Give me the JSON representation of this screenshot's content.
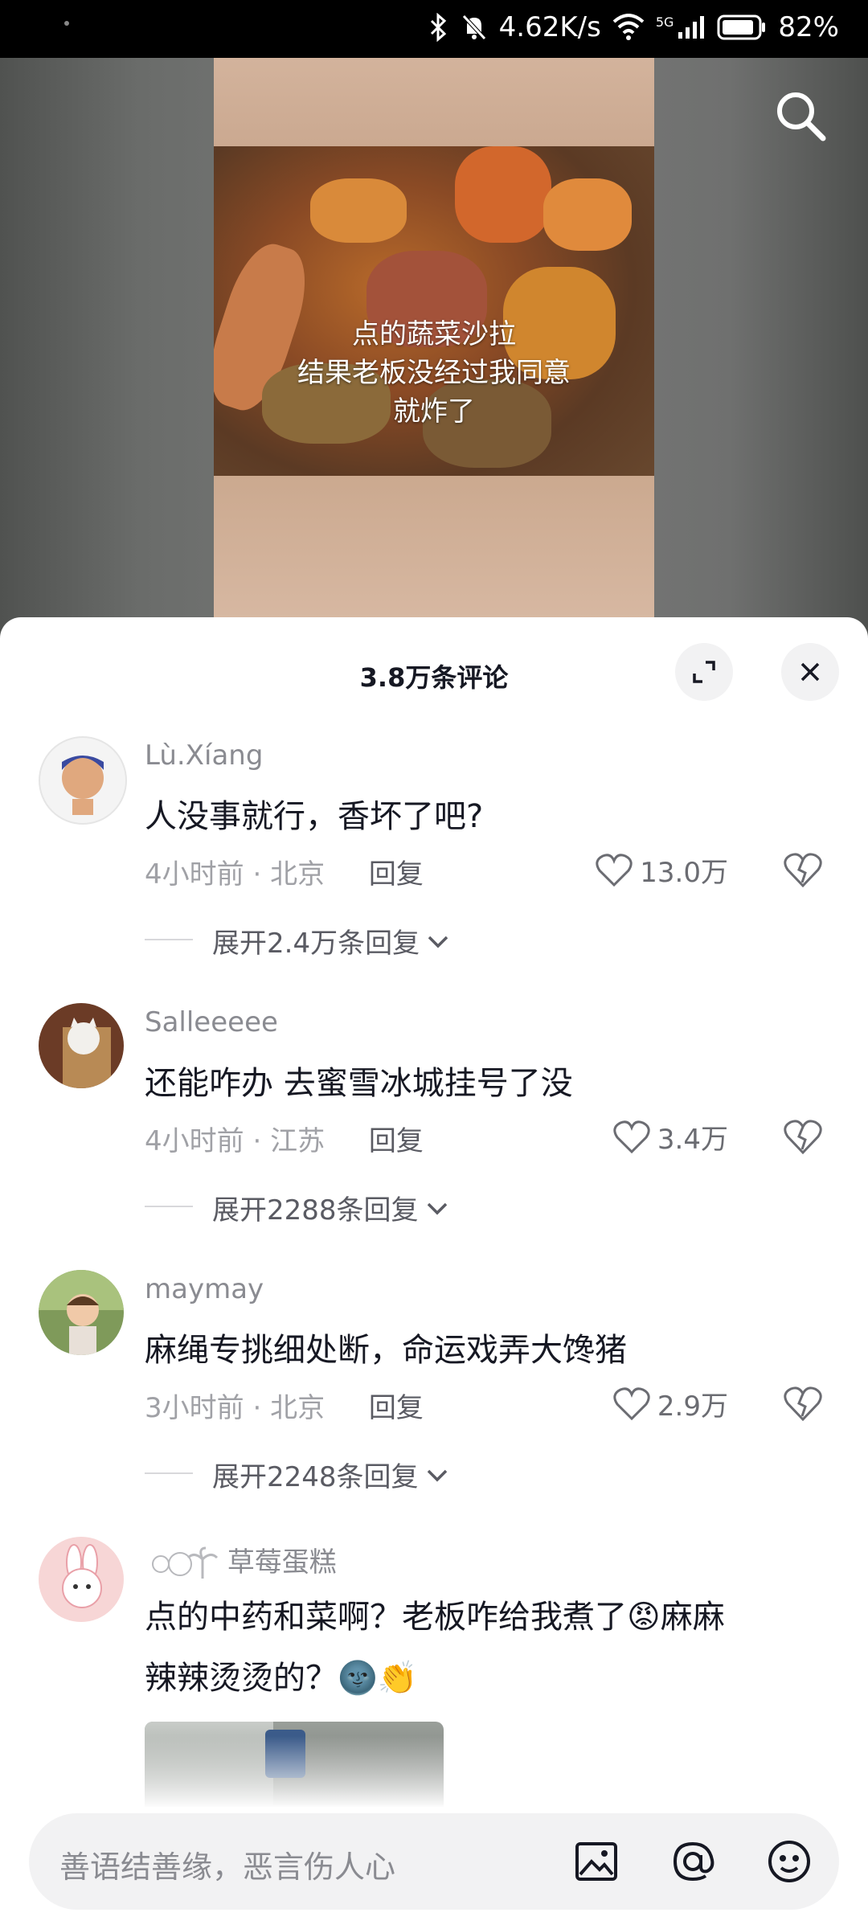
{
  "status_bar": {
    "net_speed": "4.62K/s",
    "signal": "5G",
    "battery": "82%"
  },
  "video": {
    "caption_lines": [
      "点的蔬菜沙拉",
      "结果老板没经过我同意",
      "就炸了"
    ]
  },
  "comments_panel": {
    "title": "3.8万条评论",
    "comments": [
      {
        "user": "Lù.Xíang",
        "text": "人没事就行，香坏了吧?",
        "time": "4小时前",
        "loc": "北京",
        "reply": "回复",
        "likes": "13.0万",
        "expand": "展开2.4万条回复"
      },
      {
        "user": "Salleeeee",
        "text": "还能咋办 去蜜雪冰城挂号了没",
        "time": "4小时前",
        "loc": "江苏",
        "reply": "回复",
        "likes": "3.4万",
        "expand": "展开2288条回复"
      },
      {
        "user": "maymay",
        "text": "麻绳专挑细处断，命运戏弄大馋猪",
        "time": "3小时前",
        "loc": "北京",
        "reply": "回复",
        "likes": "2.9万",
        "expand": "展开2248条回复"
      },
      {
        "user": "草莓蛋糕",
        "text_line1": "点的中药和菜啊？老板咋给我煮了",
        "text_emoji1": "😡",
        "text_line1b": "麻麻",
        "text_line2": "辣辣烫烫的？",
        "text_emoji2": "🌚👏"
      }
    ]
  },
  "input_bar": {
    "placeholder": "善语结善缘，恶言伤人心"
  }
}
